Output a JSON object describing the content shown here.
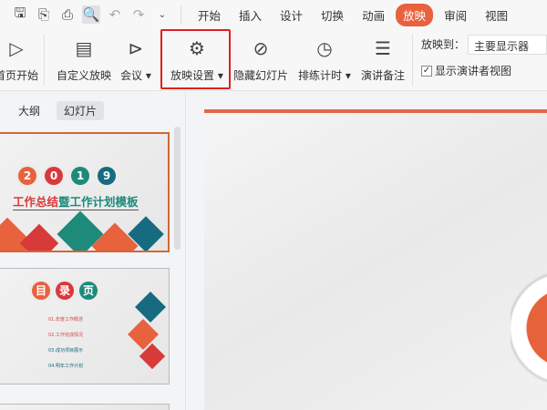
{
  "quick_access": [
    "save-icon",
    "export-icon",
    "print-icon",
    "preview-icon",
    "undo-icon",
    "redo-icon",
    "customize-icon"
  ],
  "tabs": [
    "开始",
    "插入",
    "设计",
    "切换",
    "动画",
    "放映",
    "审阅",
    "视图"
  ],
  "active_tab": "放映",
  "ribbon": {
    "from_start": "首页开始",
    "custom_show": "自定义放映",
    "meeting": "会议",
    "show_settings": "放映设置",
    "hide_slide": "隐藏幻灯片",
    "rehearse": "排练计时",
    "speaker_notes": "演讲备注",
    "show_to_label": "放映到：",
    "show_to_value": "主要显示器",
    "presenter_view": "显示演讲者视图",
    "presenter_view_checked": true
  },
  "panel": {
    "tabs": [
      "大纲",
      "幻灯片"
    ],
    "active": "幻灯片"
  },
  "slide1": {
    "digits": [
      "2",
      "0",
      "1",
      "9"
    ],
    "title_a": "工作总结",
    "title_b": "暨工作计划模板"
  },
  "slide2": {
    "circles": [
      "目",
      "录",
      "页"
    ],
    "items": [
      "01.年度工作概述",
      "02.工作完成情况",
      "03.成功项目展示",
      "04.明年工作计划"
    ]
  },
  "colors": {
    "accent": "#e8623e",
    "highlight": "#e02020"
  }
}
